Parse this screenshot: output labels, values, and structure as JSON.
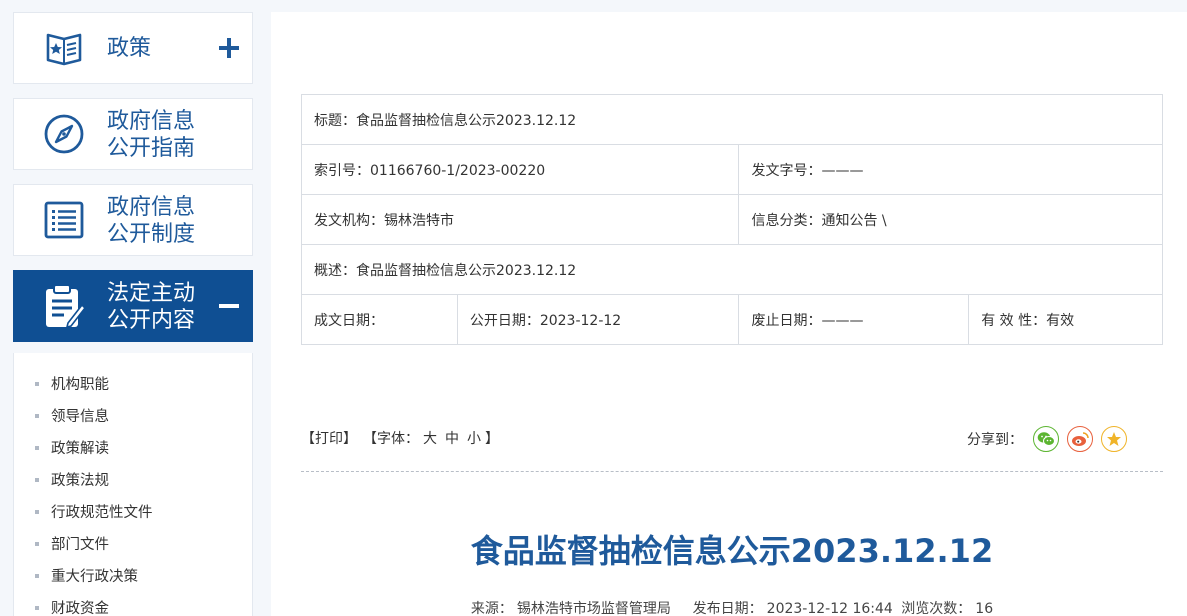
{
  "sidebar": {
    "items": [
      {
        "label_1": "政策",
        "label_2": "",
        "icon": "policy-book-icon",
        "toggle": "plus"
      },
      {
        "label_1": "政府信息",
        "label_2": "公开指南",
        "icon": "compass-icon"
      },
      {
        "label_1": "政府信息",
        "label_2": "公开制度",
        "icon": "list-document-icon"
      },
      {
        "label_1": "法定主动",
        "label_2": "公开内容",
        "icon": "clipboard-edit-icon",
        "toggle": "minus"
      }
    ],
    "sub_items": [
      "机构职能",
      "领导信息",
      "政策解读",
      "政策法规",
      "行政规范性文件",
      "部门文件",
      "重大行政决策",
      "财政资金"
    ]
  },
  "meta": {
    "title": "标题：食品监督抽检信息公示2023.12.12",
    "index_no": "索引号：01166760-1/2023-00220",
    "doc_no": "发文字号：———",
    "issuer": "发文机构：锡林浩特市",
    "category": "信息分类：通知公告 \\",
    "summary": "概述：食品监督抽检信息公示2023.12.12",
    "created": "成文日期：",
    "published": "公开日期：2023-12-12",
    "expired": "废止日期：———",
    "validity": "有 效 性：有效"
  },
  "toolbar": {
    "print": "【打印】",
    "font_prefix": "【字体：",
    "font_large": "大",
    "font_medium": "中",
    "font_small": "小",
    "font_suffix": "】",
    "share_label": "分享到："
  },
  "article": {
    "title": "食品监督抽检信息公示2023.12.12",
    "source_label": "来源：",
    "source": "锡林浩特市场监督管理局",
    "date_label": "发布日期：",
    "date": "2023-12-12 16:44",
    "views_label": "浏览次数：",
    "views": "16"
  },
  "colors": {
    "primary": "#1f5a9b",
    "active_bg": "#0f4f93",
    "wechat": "#5cb531",
    "weibo": "#e8603c",
    "favorite": "#f0b429"
  }
}
